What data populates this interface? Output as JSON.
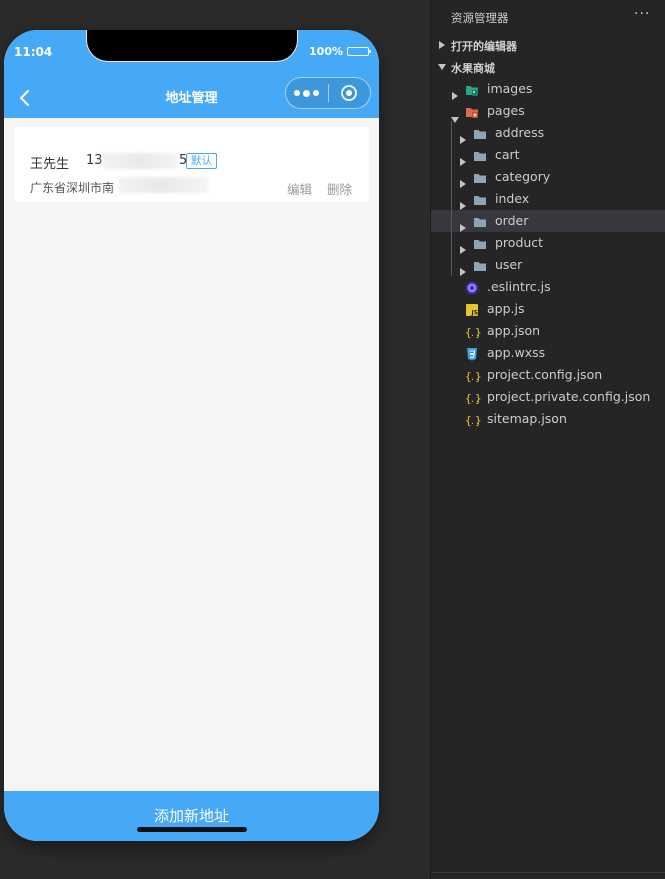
{
  "simulator": {
    "status": {
      "time": "11:04",
      "battery": "100%"
    },
    "nav": {
      "title": "地址管理"
    },
    "address_card": {
      "name": "王先生",
      "phone_visible": "13",
      "phone_tail": "5",
      "default_badge": "默认",
      "address_visible": "广东省深圳市南",
      "edit_label": "编辑",
      "delete_label": "删除"
    },
    "add_button_label": "添加新地址"
  },
  "explorer": {
    "title": "资源管理器",
    "more": "···",
    "sections": [
      {
        "label": "打开的编辑器",
        "expanded": false
      },
      {
        "label": "水果商城",
        "expanded": true
      }
    ],
    "tree": [
      {
        "label": "images",
        "type": "folder",
        "icon": "images-folder-icon"
      },
      {
        "label": "pages",
        "type": "folder",
        "icon": "pages-folder-icon",
        "expanded": true
      },
      {
        "label": "address",
        "type": "folder",
        "icon": "folder-icon"
      },
      {
        "label": "cart",
        "type": "folder",
        "icon": "folder-icon"
      },
      {
        "label": "category",
        "type": "folder",
        "icon": "folder-icon"
      },
      {
        "label": "index",
        "type": "folder",
        "icon": "folder-icon"
      },
      {
        "label": "order",
        "type": "folder",
        "icon": "folder-icon",
        "selected": true
      },
      {
        "label": "product",
        "type": "folder",
        "icon": "folder-icon"
      },
      {
        "label": "user",
        "type": "folder",
        "icon": "folder-icon"
      },
      {
        "label": ".eslintrc.js",
        "type": "file",
        "icon": "eslint-icon"
      },
      {
        "label": "app.js",
        "type": "file",
        "icon": "js-file-icon"
      },
      {
        "label": "app.json",
        "type": "file",
        "icon": "json-file-icon"
      },
      {
        "label": "app.wxss",
        "type": "file",
        "icon": "css-file-icon"
      },
      {
        "label": "project.config.json",
        "type": "file",
        "icon": "json-file-icon"
      },
      {
        "label": "project.private.config.json",
        "type": "file",
        "icon": "json-file-icon"
      },
      {
        "label": "sitemap.json",
        "type": "file",
        "icon": "json-file-icon"
      }
    ]
  },
  "colors": {
    "accent": "#45a9f7",
    "explorer_bg": "#252526",
    "selected_row": "#37373d",
    "folder": "#8aa4b8",
    "json": "#e9c23c",
    "js": "#e5c52f",
    "css": "#3d9ae8"
  }
}
